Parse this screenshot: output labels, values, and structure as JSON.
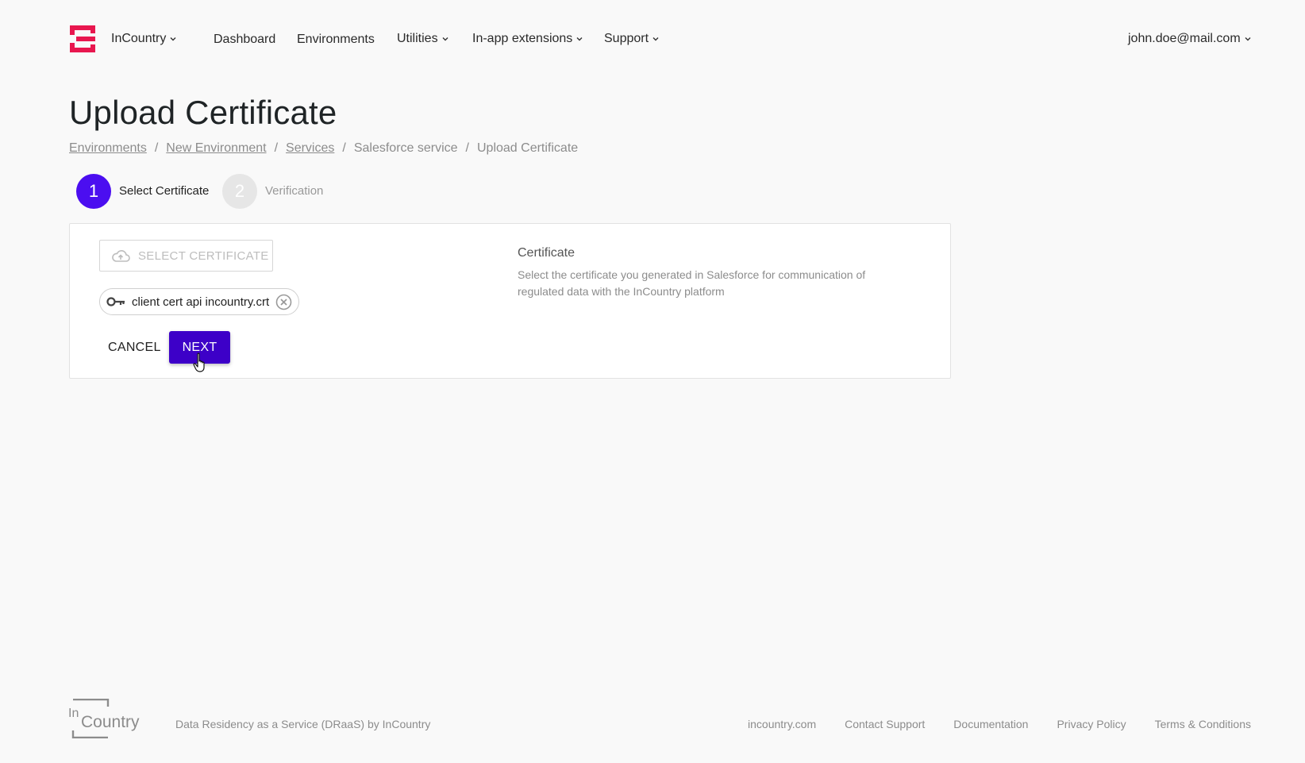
{
  "header": {
    "org_label": "InCountry",
    "nav": {
      "dashboard": "Dashboard",
      "environments": "Environments",
      "utilities": "Utilities",
      "extensions": "In-app extensions",
      "support": "Support"
    },
    "user_email": "john.doe@mail.com"
  },
  "page": {
    "title": "Upload Certificate",
    "breadcrumb": {
      "environments": "Environments",
      "new_environment": "New Environment",
      "services": "Services",
      "salesforce_service": "Salesforce service",
      "current": "Upload Certificate",
      "separator": "/"
    }
  },
  "stepper": {
    "step1": {
      "number": "1",
      "label": "Select Certificate",
      "active": true
    },
    "step2": {
      "number": "2",
      "label": "Verification",
      "active": false
    }
  },
  "form": {
    "select_button": "SELECT CERTIFICATE",
    "file_name": "client cert api incountry.crt",
    "cancel_label": "CANCEL",
    "next_label": "NEXT",
    "info_title": "Certificate",
    "info_description": "Select the certificate you generated in Salesforce for communication of regulated data with the InCountry platform"
  },
  "footer": {
    "logo_text_top": "In",
    "logo_text_bottom": "Country",
    "tagline": "Data Residency as a Service (DRaaS) by InCountry",
    "links": {
      "site": "incountry.com",
      "contact": "Contact Support",
      "docs": "Documentation",
      "privacy": "Privacy Policy",
      "terms": "Terms & Conditions"
    }
  },
  "colors": {
    "brand_red": "#e8174f",
    "primary_purple": "#3d00c8",
    "step_active": "#4b0ef0",
    "step_inactive": "#e6e6e6"
  },
  "icons": {
    "logo": "incountry-logo-icon",
    "chevron": "chevron-down-icon",
    "upload": "cloud-upload-icon",
    "key": "key-icon",
    "remove": "close-circle-icon",
    "cursor": "hand-pointer-icon"
  }
}
